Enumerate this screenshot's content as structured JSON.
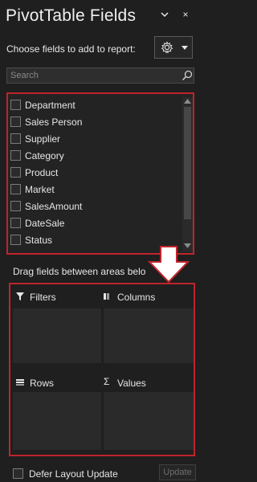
{
  "header": {
    "title": "PivotTable Fields",
    "close_glyph": "×"
  },
  "toolbar": {
    "choose_label": "Choose fields to add to report:",
    "settings_icon": "gear-icon"
  },
  "search": {
    "placeholder": "Search",
    "value": ""
  },
  "fields": [
    {
      "label": "Department",
      "checked": false
    },
    {
      "label": "Sales Person",
      "checked": false
    },
    {
      "label": "Supplier",
      "checked": false
    },
    {
      "label": "Category",
      "checked": false
    },
    {
      "label": "Product",
      "checked": false
    },
    {
      "label": "Market",
      "checked": false
    },
    {
      "label": "SalesAmount",
      "checked": false
    },
    {
      "label": "DateSale",
      "checked": false
    },
    {
      "label": "Status",
      "checked": false
    }
  ],
  "areas": {
    "drag_label": "Drag fields between areas belo",
    "filters_label": "Filters",
    "columns_label": "Columns",
    "rows_label": "Rows",
    "values_label": "Values",
    "values_symbol": "Σ"
  },
  "footer": {
    "defer_label": "Defer Layout Update",
    "update_label": "Update"
  },
  "colors": {
    "background": "#1f1f1f",
    "highlight_border": "#c0242b",
    "text": "#e6e6e6"
  }
}
